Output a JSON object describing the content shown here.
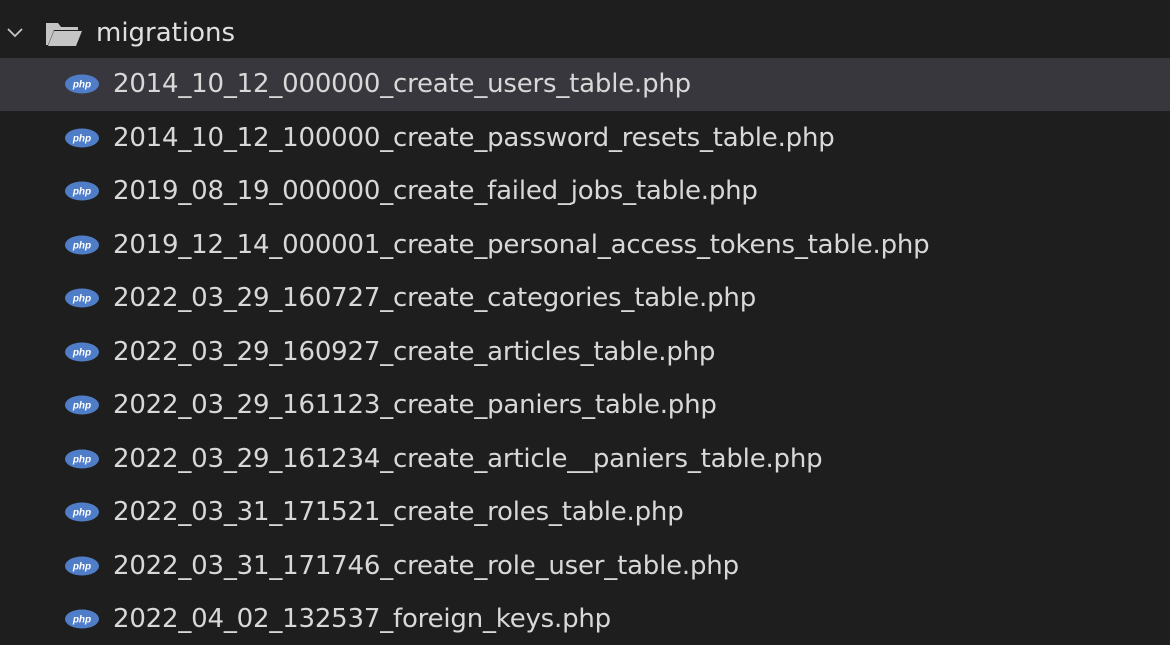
{
  "explorer": {
    "folder": {
      "name": "migrations",
      "icon": "folder-open-icon",
      "expanded": true,
      "chevron_icon": "chevron-down-icon"
    },
    "file_icon": "php-file-icon",
    "file_icon_text": "php",
    "file_icon_color": "#4f7dc7",
    "selected_row_color": "#37373d",
    "files": [
      {
        "name": "2014_10_12_000000_create_users_table.php",
        "selected": true
      },
      {
        "name": "2014_10_12_100000_create_password_resets_table.php"
      },
      {
        "name": "2019_08_19_000000_create_failed_jobs_table.php"
      },
      {
        "name": "2019_12_14_000001_create_personal_access_tokens_table.php"
      },
      {
        "name": "2022_03_29_160727_create_categories_table.php"
      },
      {
        "name": "2022_03_29_160927_create_articles_table.php"
      },
      {
        "name": "2022_03_29_161123_create_paniers_table.php"
      },
      {
        "name": "2022_03_29_161234_create_article__paniers_table.php"
      },
      {
        "name": "2022_03_31_171521_create_roles_table.php"
      },
      {
        "name": "2022_03_31_171746_create_role_user_table.php"
      },
      {
        "name": "2022_04_02_132537_foreign_keys.php"
      }
    ]
  }
}
